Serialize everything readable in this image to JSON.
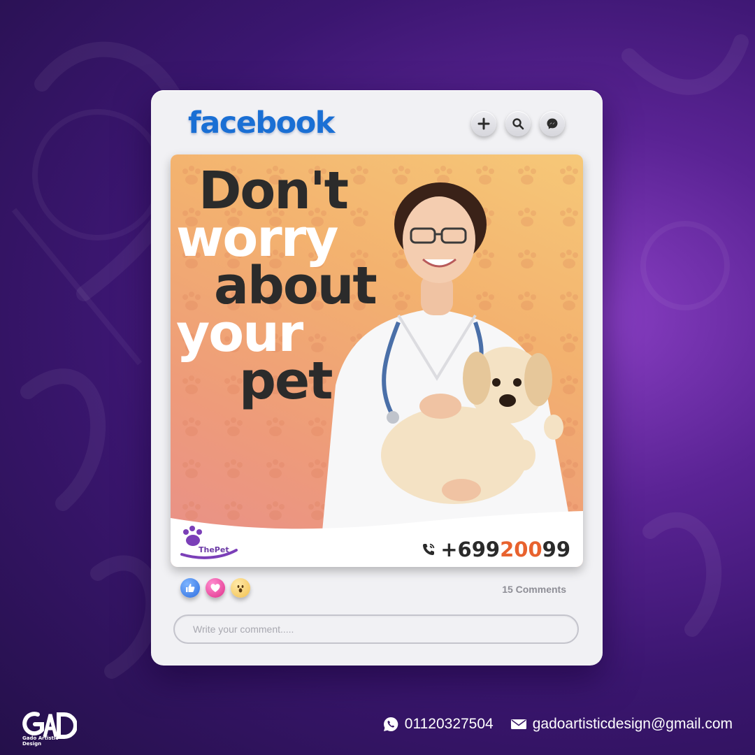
{
  "app": {
    "logo_text": "facebook"
  },
  "toolbar": {
    "icons": [
      "plus-icon",
      "search-icon",
      "messenger-icon"
    ]
  },
  "post": {
    "headline": [
      "Don't",
      "worry",
      "about",
      "your",
      "pet"
    ],
    "brand_name": "ThePet",
    "phone_prefix": "+699",
    "phone_highlight": "200",
    "phone_suffix": "99"
  },
  "reactions": [
    "like-icon",
    "love-icon",
    "wow-icon"
  ],
  "comments": {
    "count_label": "15 Comments",
    "placeholder": "Write your comment....."
  },
  "footer": {
    "brand_logo": "GAD",
    "brand_name": "Gado Artistic Design",
    "phone": "01120327504",
    "email": "gadoartisticdesign@gmail.com"
  },
  "colors": {
    "facebook_blue": "#1a6fd4",
    "phone_highlight": "#e8622e",
    "background": "#4a1c80",
    "card": "#f1f1f4"
  }
}
